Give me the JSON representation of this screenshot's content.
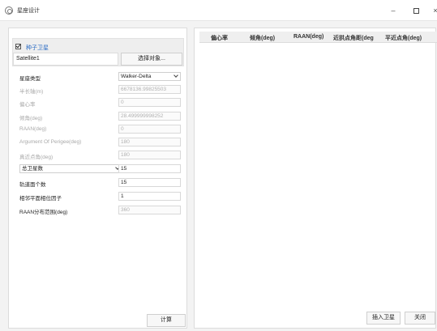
{
  "window": {
    "title": "星座设计",
    "minimize": "–",
    "close": "×"
  },
  "seed": {
    "checkbox_label": "种子卫星",
    "satellite": "Satellite1",
    "select_button": "选择对象..."
  },
  "fields": {
    "constellation_type_label": "星座类型",
    "constellation_type_value": "Walker-Delta",
    "semi_major_label": "半长轴(m)",
    "semi_major_value": "6678136.99825503",
    "eccentricity_label": "偏心率",
    "eccentricity_value": "0",
    "inclination_label": "倾角(deg)",
    "inclination_value": "28.499999998252",
    "raan_label": "RAAN(deg)",
    "raan_value": "0",
    "arg_perigee_label": "Argument Of Perigee(deg)",
    "arg_perigee_value": "180",
    "true_anomaly_label": "真近点角(deg)",
    "true_anomaly_value": "180",
    "total_sat_option": "总卫星数",
    "total_sat_value": "15",
    "orbit_count_label": "轨道面个数",
    "orbit_count_value": "15",
    "phase_factor_label": "相邻平面相位因子",
    "phase_factor_value": "1",
    "raan_range_label": "RAAN分布范围(deg)",
    "raan_range_value": "360"
  },
  "buttons": {
    "calculate": "计算",
    "insert": "插入卫星",
    "close": "关闭"
  },
  "table": {
    "headers": [
      "偏心率",
      "倾角(deg)",
      "RAAN(deg)",
      "近拱点角距(deg",
      "平近点角(deg)"
    ]
  }
}
